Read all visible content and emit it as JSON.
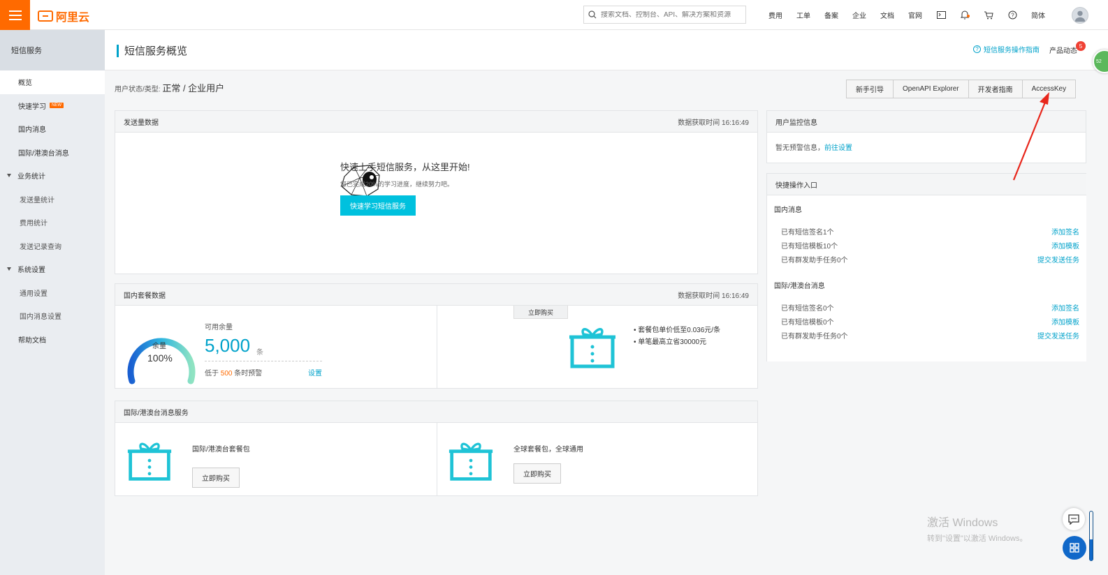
{
  "topbar": {
    "logo_text": "阿里云",
    "search_placeholder": "搜索文档、控制台、API、解决方案和资源",
    "nav": [
      "费用",
      "工单",
      "备案",
      "企业",
      "文档",
      "官网"
    ],
    "lang": "简体"
  },
  "sidebar": {
    "title": "短信服务",
    "items": [
      {
        "label": "概览"
      },
      {
        "label": "快速学习",
        "badge": "NEW"
      },
      {
        "label": "国内消息"
      },
      {
        "label": "国际/港澳台消息"
      },
      {
        "label": "业务统计"
      },
      {
        "label": "发送量统计"
      },
      {
        "label": "费用统计"
      },
      {
        "label": "发送记录查询"
      },
      {
        "label": "系统设置"
      },
      {
        "label": "通用设置"
      },
      {
        "label": "国内消息设置"
      },
      {
        "label": "帮助文档"
      }
    ]
  },
  "header": {
    "title": "短信服务概览",
    "guide_link": "短信服务操作指南",
    "product_news": "产品动态",
    "news_count": "5",
    "float_badge": "52"
  },
  "status": {
    "label": "用户状态/类型:",
    "value": "正常 / 企业用户"
  },
  "buttons": [
    "新手引导",
    "OpenAPI Explorer",
    "开发者指南",
    "AccessKey"
  ],
  "send_panel": {
    "title": "发送量数据",
    "time": "数据获取时间 16:16:49",
    "welcome_title": "快速上手短信服务，从这里开始!",
    "welcome_sub": "您已完成20%的学习进度，继续努力吧。",
    "cta": "快速学习短信服务"
  },
  "package_panel": {
    "title": "国内套餐数据",
    "time": "数据获取时间 16:16:49",
    "gauge_label": "余量",
    "gauge_percent": "100%",
    "gauge_fraction": 1.0,
    "available_label": "可用余量",
    "available_value": "5,000",
    "available_unit": "条",
    "warn_prefix": "低于",
    "warn_value": "500",
    "warn_suffix": "条时预警",
    "set_link": "设置",
    "buy_tab": "立即购买",
    "bullets": [
      "套餐包单价低至0.036元/条",
      "单笔最高立省30000元"
    ]
  },
  "intl_panel": {
    "title": "国际/港澳台消息服务",
    "left_text": "国际/港澳台套餐包",
    "left_btn": "立即购买",
    "right_text": "全球套餐包，全球通用",
    "right_btn": "立即购买"
  },
  "monitor_panel": {
    "title": "用户监控信息",
    "text": "暂无预警信息，",
    "link": "前往设置"
  },
  "quick_panel": {
    "title": "快捷操作入口",
    "domestic_title": "国内消息",
    "domestic": [
      {
        "label": "已有短信签名1个",
        "action": "添加签名"
      },
      {
        "label": "已有短信模板10个",
        "action": "添加模板"
      },
      {
        "label": "已有群发助手任务0个",
        "action": "提交发送任务"
      }
    ],
    "intl_title": "国际/港澳台消息",
    "intl": [
      {
        "label": "已有短信签名0个",
        "action": "添加签名"
      },
      {
        "label": "已有短信模板0个",
        "action": "添加模板"
      },
      {
        "label": "已有群发助手任务0个",
        "action": "提交发送任务"
      }
    ]
  },
  "watermark": {
    "line1": "激活 Windows",
    "line2": "转到\"设置\"以激活 Windows。"
  },
  "colors": {
    "brand": "#ff6a00",
    "accent": "#00a2ca",
    "primary_button": "#00c1de",
    "arrow": "#e8261b"
  }
}
